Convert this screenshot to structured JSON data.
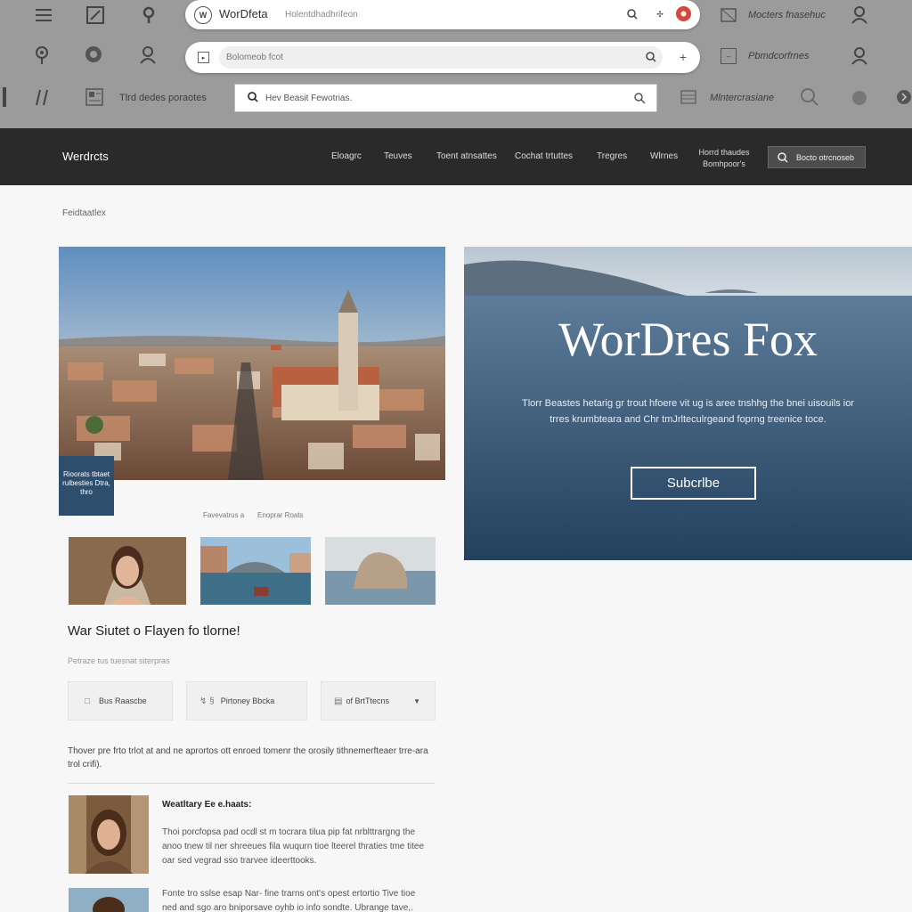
{
  "chrome": {
    "row1": {
      "url_label": "WorDfeta",
      "url_text": "Holentdhadhrifeon",
      "right_text": "Mocters fnasehuc"
    },
    "row2": {
      "url_text": "Bolomeob fcot",
      "right_text": "Pbmdcorfrnes"
    },
    "row3": {
      "left_text": "Tlrd dedes poraotes",
      "search_text": "Hev Beasit Fewotrias.",
      "right_text": "Mlntercrasiane"
    }
  },
  "header": {
    "brand": "Werdrcts",
    "nav": [
      "Eloagrc",
      "Teuves",
      "Toent atnsattes",
      "Cochat trtuttes",
      "Tregres",
      "Wlrnes"
    ],
    "nav_extra": "Horrd thaudes Bomhpoor's",
    "search": "Bocto otrcnoseb"
  },
  "breadcrumb": "Feidtaatlex",
  "hero_left": {
    "badge": "Rioorats tbtaet rulbesties Dtra, thro",
    "captions": [
      "Favevatrus a",
      "Enoprar Roats"
    ]
  },
  "hero_right": {
    "title": "WorDres Fox",
    "description": "Tlorr Beastes hetarig gr trout hfoere vit ug is aree tnshhg the bnei uisouils ior trres krumbteara and Chr tmJrlteculrgeand foprng treenice toce.",
    "button": "Subcrlbe"
  },
  "section": {
    "title": "War Siutet o Flayen fo tlorne!",
    "subtitle": "Petraze tus tuesnat siterpras",
    "filters": [
      {
        "icon": "□",
        "label": "Bus Raascbe"
      },
      {
        "icon": "↯ §",
        "label": "Pirtoney Bbcka"
      },
      {
        "icon": "▤",
        "label": "of BrtTtecns"
      }
    ],
    "paragraph": "Thover pre frto trlot at and ne aprortos ott enroed tomenr the orosily tithnemerfteaer trre-ara trol crifi)."
  },
  "post": {
    "title": "Weatltary Ee e.haats:",
    "text1": "Thoi porcfopsa pad ocdl st m tocrara tilua pip fat nrblttrargng the anoo tnew til ner shreeues fila wuqurn tioe lteerel thraties tme titee oar sed vegrad sso trarvee ideerttooks.",
    "text2": "Fonte tro sslse esap Nar- fine trarns ont's opest ertortio Tive tioe ned and sgo aro bniporsave oyhb io info sondte. Ubrange tave,."
  }
}
